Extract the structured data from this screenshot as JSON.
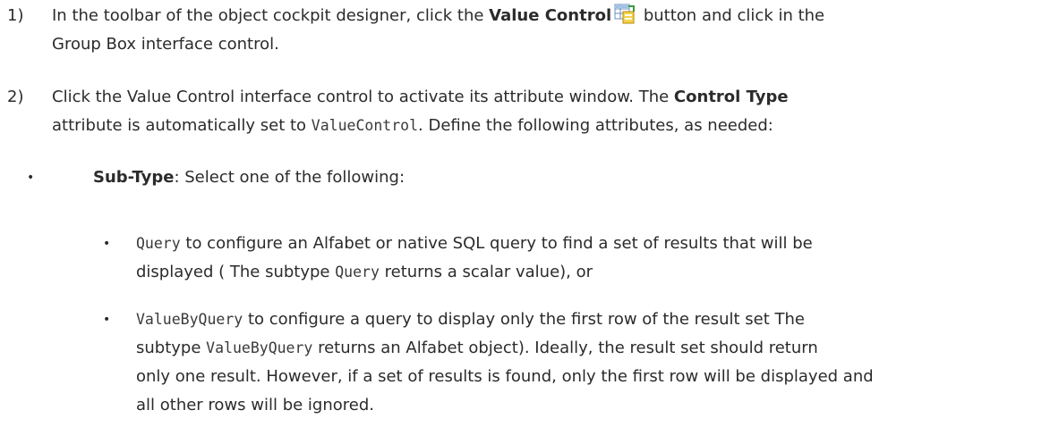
{
  "steps": [
    {
      "number": "1)",
      "line1_a": "In the toolbar of the object cockpit designer, click the ",
      "line1_bold": "Value Control",
      "line1_b": " button and click in the",
      "line2": "Group Box interface control."
    },
    {
      "number": "2)",
      "line1_a": "Click the Value Control interface control to activate its attribute window. The ",
      "line1_bold": "Control Type",
      "line2_a": "attribute is automatically set to ",
      "line2_code": "ValueControl",
      "line2_b": ". Define the following attributes, as needed:"
    }
  ],
  "subtype": {
    "bullet": "•",
    "label": "Sub-Type",
    "text": ": Select one of the following:"
  },
  "options": [
    {
      "bullet": "•",
      "code": "Query",
      "line1": " to configure an Alfabet or native SQL query to find a set of results that will be",
      "line2_a": "displayed ( The subtype ",
      "line2_code": "Query",
      "line2_b": " returns a scalar value), or"
    },
    {
      "bullet": "•",
      "code": "ValueByQuery",
      "line1": " to configure a query to display only the first row of the result set The",
      "line2_a": "subtype ",
      "line2_code": "ValueByQuery",
      "line2_b": " returns an Alfabet object). Ideally, the result set should return",
      "line3": "only one result. However, if a set of results is found, only the first row will be displayed and",
      "line4": "all other rows will be ignored."
    }
  ],
  "icons": {
    "value_control": "value-control-icon"
  }
}
